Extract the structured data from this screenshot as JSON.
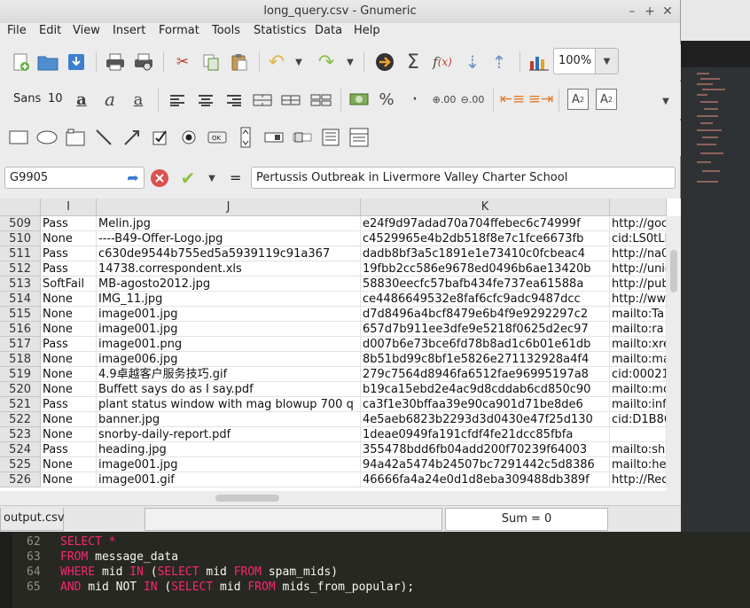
{
  "window": {
    "title": "long_query.csv - Gnumeric"
  },
  "menu": [
    "File",
    "Edit",
    "View",
    "Insert",
    "Format",
    "Tools",
    "Statistics",
    "Data",
    "Help"
  ],
  "toolbar": {
    "zoom": "100%",
    "font_name": "Sans",
    "font_size": "10"
  },
  "edit_line": {
    "cell_ref": "G9905",
    "equals": "=",
    "content": "Pertussis Outbreak in Livermore Valley Charter School"
  },
  "columns": [
    "I",
    "J",
    "K",
    ""
  ],
  "rows": [
    {
      "n": "509",
      "i": "Pass",
      "j": "Melin.jpg",
      "k": "e24f9d97adad70a704ffebec6c74999f",
      "l": "http://goo"
    },
    {
      "n": "510",
      "i": "None",
      "j": "----B49-Offer-Logo.jpg",
      "k": "c4529965e4b2db518f8e7c1fce6673fb",
      "l": "cid:LS0tLL"
    },
    {
      "n": "511",
      "i": "Pass",
      "j": "c630de9544b755ed5a5939119c91a367",
      "k": "dadb8bf3a5c1891e1e73410c0fcbeac4",
      "l": "http://na0"
    },
    {
      "n": "512",
      "i": "Pass",
      "j": "14738.correspondent.xls",
      "k": "19fbb2cc586e9678ed0496b6ae13420b",
      "l": "http://unic"
    },
    {
      "n": "513",
      "i": "SoftFail",
      "j": "MB-agosto2012.jpg",
      "k": "58830eecfc57bafb434fe737ea61588a",
      "l": "http://pub"
    },
    {
      "n": "514",
      "i": "None",
      "j": "IMG_11.jpg",
      "k": "ce4486649532e8faf6cfc9adc9487dcc",
      "l": "http://ww"
    },
    {
      "n": "515",
      "i": "None",
      "j": "image001.jpg",
      "k": "d7d8496a4bcf8479e6b4f9e9292297c2",
      "l": "mailto:Ta"
    },
    {
      "n": "516",
      "i": "None",
      "j": "image001.jpg",
      "k": "657d7b911ee3dfe9e5218f0625d2ec97",
      "l": "mailto:ra"
    },
    {
      "n": "517",
      "i": "Pass",
      "j": "image001.png",
      "k": "d007b6e73bce6fd78b8ad1c6b01e61db",
      "l": "mailto:xre"
    },
    {
      "n": "518",
      "i": "None",
      "j": "image006.jpg",
      "k": "8b51bd99c8bf1e5826e271132928a4f4",
      "l": "mailto:ma"
    },
    {
      "n": "519",
      "i": "None",
      "j": "4.9卓越客户服务技巧.gif",
      "k": "279c7564d8946fa6512fae96995197a8",
      "l": "cid:00021"
    },
    {
      "n": "520",
      "i": "None",
      "j": "Buffett says do as I say.pdf",
      "k": "b19ca15ebd2e4ac9d8cddab6cd850c90",
      "l": "mailto:mo"
    },
    {
      "n": "521",
      "i": "Pass",
      "j": "plant  status window with mag blowup 700 q",
      "k": "ca3f1e30bffaa39e90ca901d71be8de6",
      "l": "mailto:inf"
    },
    {
      "n": "522",
      "i": "None",
      "j": "banner.jpg",
      "k": "4e5aeb6823b2293d3d0430e47f25d130",
      "l": "cid:D1B86"
    },
    {
      "n": "523",
      "i": "None",
      "j": "snorby-daily-report.pdf",
      "k": "1deae0949fa191cfdf4fe21dcc85fbfa",
      "l": ""
    },
    {
      "n": "524",
      "i": "Pass",
      "j": "heading.jpg",
      "k": "355478bdd6fb04add200f70239f64003",
      "l": "mailto:sh"
    },
    {
      "n": "525",
      "i": "None",
      "j": "image001.jpg",
      "k": "94a42a5474b24507bc7291442c5d8386",
      "l": "mailto:he"
    },
    {
      "n": "526",
      "i": "None",
      "j": "image001.gif",
      "k": "46666fa4a24e0d1d8eba309488db389f",
      "l": "http://Red"
    }
  ],
  "status": {
    "sheet_tab": "output.csv",
    "sum": "Sum = 0"
  },
  "editor": {
    "lines": [
      {
        "n": "62",
        "parts": [
          {
            "t": "SELECT",
            "k": true
          },
          {
            "t": " *",
            "k": true
          }
        ]
      },
      {
        "n": "63",
        "parts": [
          {
            "t": "FROM",
            "k": true
          },
          {
            "t": " message_data",
            "k": false
          }
        ]
      },
      {
        "n": "64",
        "parts": [
          {
            "t": "WHERE",
            "k": true
          },
          {
            "t": " mid ",
            "k": false
          },
          {
            "t": "IN",
            "k": true
          },
          {
            "t": " (",
            "k": false
          },
          {
            "t": "SELECT",
            "k": true
          },
          {
            "t": " mid ",
            "k": false
          },
          {
            "t": "FROM",
            "k": true
          },
          {
            "t": " spam_mids)",
            "k": false
          }
        ]
      },
      {
        "n": "65",
        "parts": [
          {
            "t": "AND",
            "k": true
          },
          {
            "t": " mid NOT ",
            "k": false
          },
          {
            "t": "IN",
            "k": true
          },
          {
            "t": " (",
            "k": false
          },
          {
            "t": "SELECT",
            "k": true
          },
          {
            "t": " mid ",
            "k": false
          },
          {
            "t": "FROM",
            "k": true
          },
          {
            "t": " mids_from_popular);",
            "k": false
          }
        ]
      }
    ]
  },
  "colors": {
    "keyword": "#f92672",
    "editor_bg": "#272822",
    "cancel_red": "#d9534f",
    "accept_green": "#8fc043"
  }
}
